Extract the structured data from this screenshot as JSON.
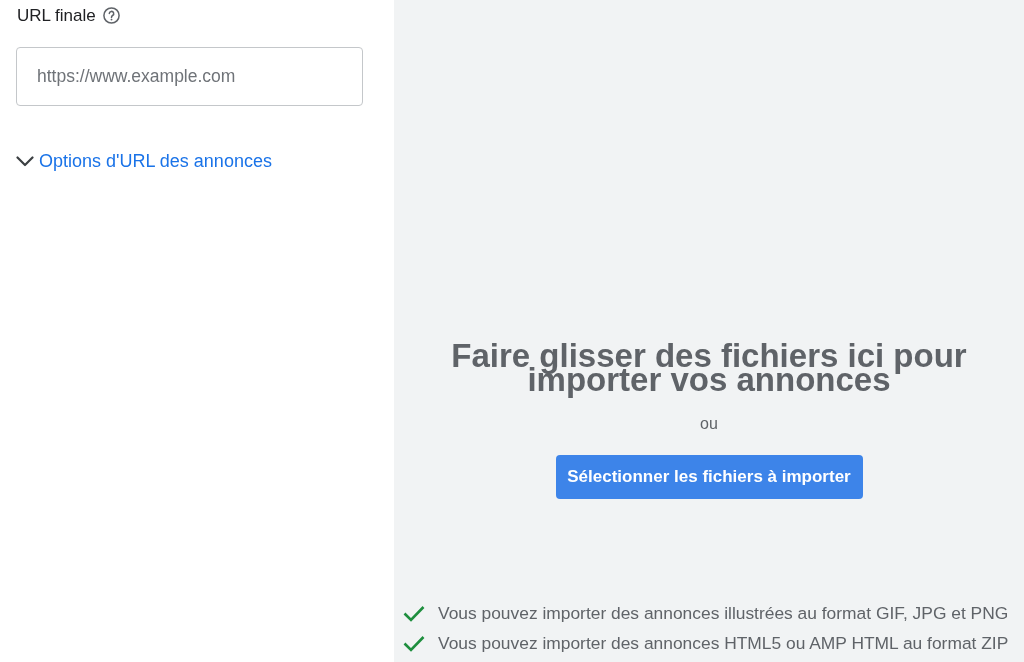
{
  "url_form": {
    "label": "URL finale",
    "input": {
      "placeholder": "https://www.example.com"
    },
    "url_options": {
      "label": "Options d'URL des annonces",
      "expanded": false
    }
  },
  "upload": {
    "heading": "Faire glisser des fichiers ici pour importer vos annonces",
    "separator": "ou",
    "button": "Sélectionner les fichiers à importer",
    "notes": [
      {
        "text": "Vous pouvez importer des annonces illustrées au format GIF, JPG et PNG"
      },
      {
        "text": "Vous pouvez importer des annonces HTML5 ou AMP HTML au format ZIP"
      }
    ]
  }
}
